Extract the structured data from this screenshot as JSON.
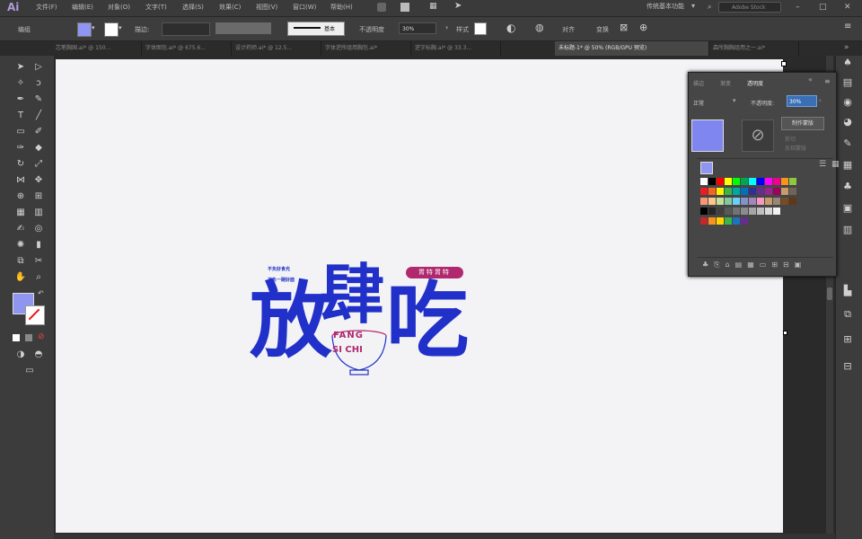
{
  "app": {
    "logo": "Ai"
  },
  "menu": [
    "文件(F)",
    "编辑(E)",
    "对象(O)",
    "文字(T)",
    "选择(S)",
    "效果(C)",
    "视图(V)",
    "窗口(W)",
    "帮助(H)"
  ],
  "workspace": "传统基本功能",
  "search_placeholder": "Adobe Stock",
  "control_bar": {
    "left_label": "编组",
    "stroke_label": "描边:",
    "stroke_value": "",
    "brush_label": "基本",
    "opacity_label": "不透明度",
    "opacity_value": "30%",
    "style_label": "样式",
    "align_label": "对齐",
    "transform_label": "变换"
  },
  "tabs": [
    {
      "label": "芯笔胸国.ai* @ 150...",
      "active": false
    },
    {
      "label": "字体图包.ai* @ 675.6...",
      "active": false
    },
    {
      "label": "设计药师.ai* @ 12.5...",
      "active": false
    },
    {
      "label": "字体逆所组用胸包.ai*",
      "active": false
    },
    {
      "label": "逆字标胸.ai* @ 33.3...",
      "active": false
    },
    {
      "label": "未标题-1* @ 50% (RGB/GPU 预览)",
      "active": true
    },
    {
      "label": "森所胸胸组用之一.ai*",
      "active": false
    }
  ],
  "panel": {
    "tabs": [
      "描边",
      "渐变",
      "透明度"
    ],
    "active_tab": "透明度",
    "blend_mode": "正常",
    "opacity_label": "不透明度:",
    "opacity_value": "30%",
    "mask_button": "制作蒙版",
    "clip_label": "剪切",
    "invert_label": "反相蒙版",
    "preview_color": "#7f86f0"
  },
  "artwork": {
    "main_char_1": "放",
    "main_char_2": "肆",
    "main_char_3": "吃",
    "pinyin_1": "FANG",
    "pinyin_2": "SI CHI",
    "badge_text": "胃特胃特",
    "small_line_1": "不负好食光",
    "small_line_2": "不负一碗好面",
    "main_color": "#2030c8",
    "accent_color": "#b0286e"
  },
  "swatch_colors": [
    [
      "#ffffff",
      "#000000",
      "#ff0000",
      "#ffff00",
      "#00ff00",
      "#00a651",
      "#00ffff",
      "#0000ff",
      "#ff00ff",
      "#ec008c",
      "#f7941d",
      "#8dc63f"
    ],
    [
      "#ed1c24",
      "#f26522",
      "#fff200",
      "#39b54a",
      "#00a99d",
      "#0072bc",
      "#2e3192",
      "#662d91",
      "#92278f",
      "#9e005d",
      "#c69c6d",
      "#736357"
    ],
    [
      "#f7977a",
      "#fdc68a",
      "#c4df9b",
      "#82ca9d",
      "#6dcff6",
      "#8393ca",
      "#a187be",
      "#f49ac2",
      "#c69c6d",
      "#998675",
      "#754c24",
      "#603913"
    ],
    [
      "#000000",
      "#262626",
      "#404040",
      "#595959",
      "#737373",
      "#8c8c8c",
      "#a6a6a6",
      "#bfbfbf",
      "#d9d9d9",
      "#f2f2f2"
    ],
    [
      "#c1272d",
      "#f7931e",
      "#ffd400",
      "#39b54a",
      "#1b75bc",
      "#662d91"
    ]
  ]
}
